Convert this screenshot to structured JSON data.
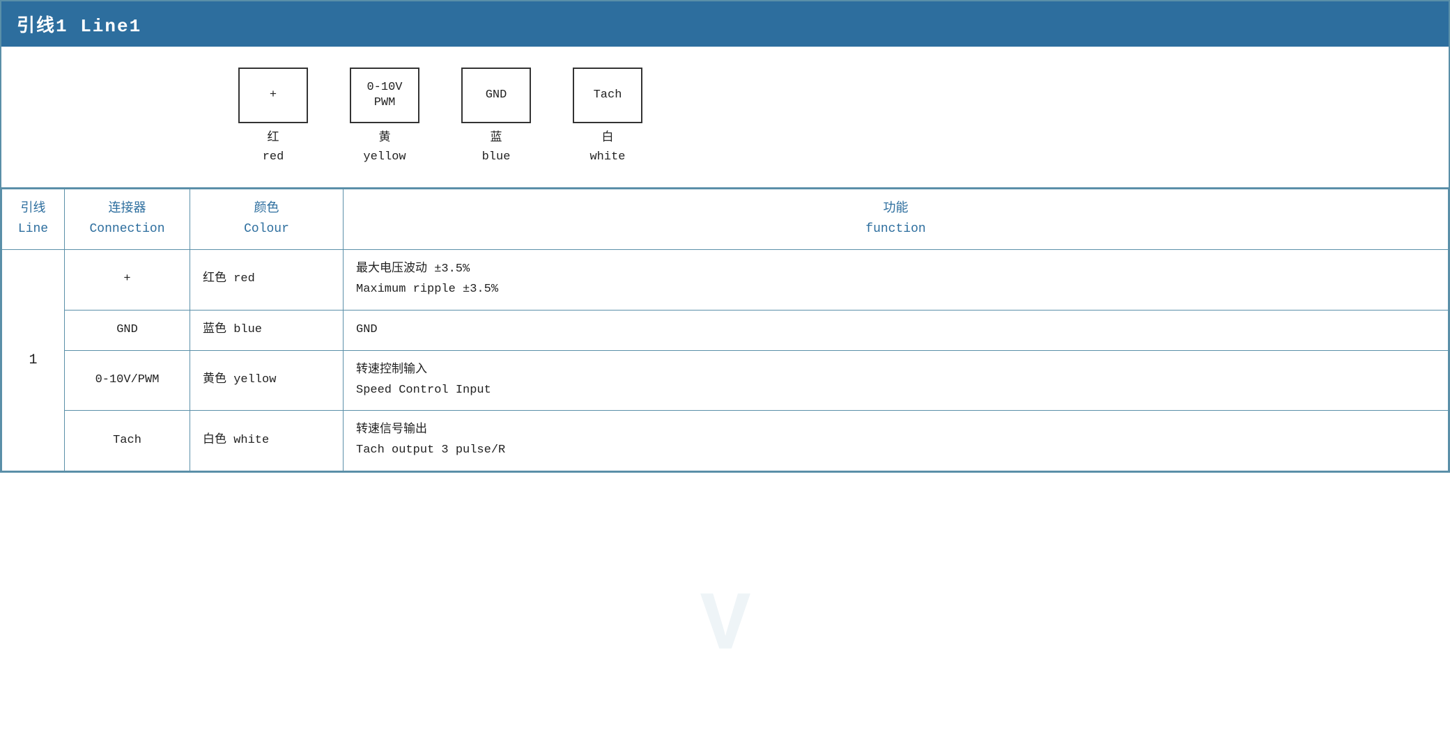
{
  "title": "引线1 Line1",
  "diagram": {
    "connectors": [
      {
        "id": "plus",
        "symbol": "+",
        "zh": "红",
        "en": "red"
      },
      {
        "id": "pwm",
        "symbol": "0-10V\nPWM",
        "zh": "黄",
        "en": "yellow"
      },
      {
        "id": "gnd",
        "symbol": "GND",
        "zh": "蓝",
        "en": "blue"
      },
      {
        "id": "tach",
        "symbol": "Tach",
        "zh": "白",
        "en": "white"
      }
    ]
  },
  "table": {
    "headers": {
      "line_zh": "引线",
      "line_en": "Line",
      "conn_zh": "连接器",
      "conn_en": "Connection",
      "colour_zh": "颜色",
      "colour_en": "Colour",
      "func_zh": "功能",
      "func_en": "function"
    },
    "rows": [
      {
        "line": "1",
        "connection": "+",
        "colour": "红色 red",
        "func_zh": "最大电压波动 ±3.5%",
        "func_en": "Maximum ripple ±3.5%"
      },
      {
        "line": "",
        "connection": "GND",
        "colour": "蓝色 blue",
        "func_zh": "GND",
        "func_en": ""
      },
      {
        "line": "",
        "connection": "0-10V/PWM",
        "colour": "黄色 yellow",
        "func_zh": "转速控制输入",
        "func_en": "Speed Control Input"
      },
      {
        "line": "",
        "connection": "Tach",
        "colour": "白色 white",
        "func_zh": "转速信号输出",
        "func_en": "Tach output 3 pulse/R"
      }
    ]
  }
}
